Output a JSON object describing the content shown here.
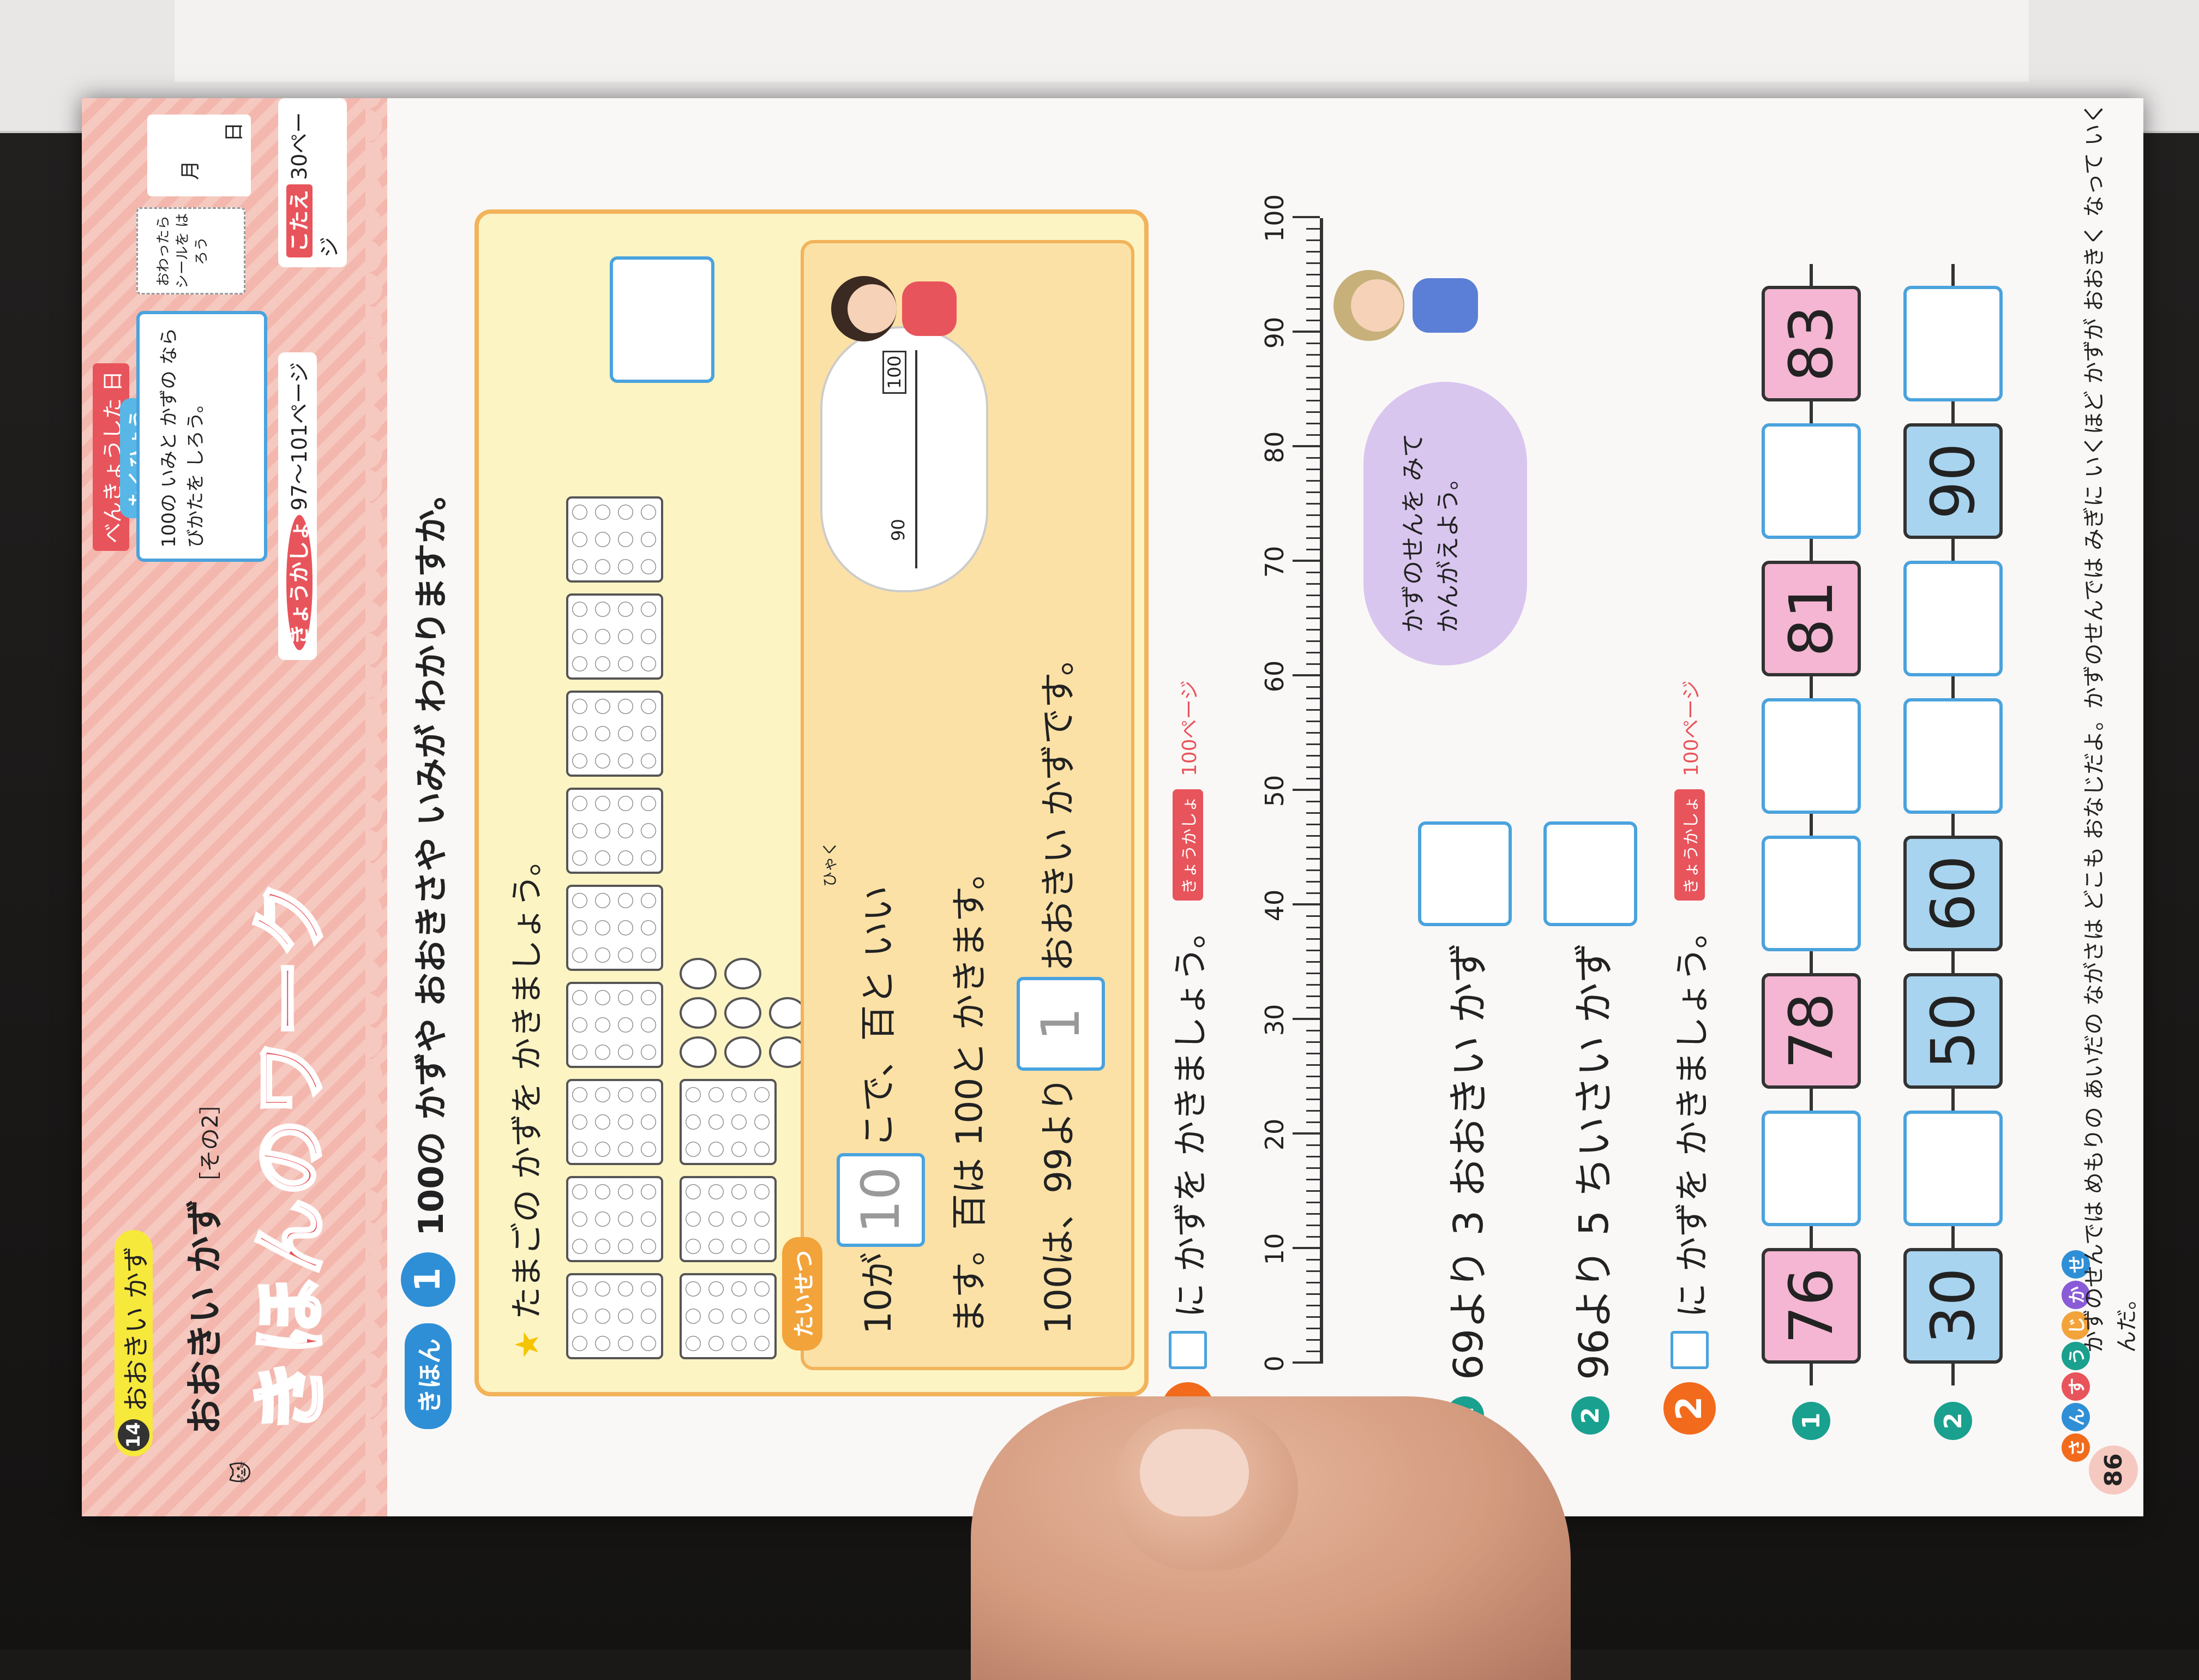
{
  "page": {
    "lesson_number": "14",
    "lesson_tag": "おおきい かず",
    "lesson_title": "おおきい かず",
    "lesson_subtitle": "［その2］",
    "work_title": "きほんのワーク",
    "studied_label": "べんきょうした 日",
    "month_label": "月",
    "day_label": "日",
    "goal_label": "もくひょう",
    "goal_text": "100の いみと かずの ならびかたを しろう。",
    "sticker_text": "おわったら シールを はろう",
    "textbook_ref_tag": "きょうかしょ",
    "textbook_ref": "97～101ページ",
    "answer_tag": "こたえ",
    "answer_ref": "30ページ",
    "page_number": "86"
  },
  "kihon1": {
    "badge": "きほん",
    "number": "1",
    "heading": "100の かずや おおきさや いみが わかりますか。",
    "instruction": "たまごの かずを かきましょう。",
    "taisetsu_label": "たいせつ",
    "line1_pre": "10が",
    "line1_box": "10",
    "line1_post": "こで、百と いい",
    "furigana": "ひゃく",
    "line2": "ます。百は 100と かきます。",
    "line3_pre": "100は、99より",
    "line3_box": "1",
    "line3_post": "おおきい かずです。",
    "cloud_label_90": "90",
    "cloud_label_100": "100"
  },
  "q1": {
    "number": "1",
    "instruction": "に かずを かきましょう。",
    "ref_tag": "きょうかしょ",
    "ref": "100ページ",
    "ruler_labels": [
      "0",
      "10",
      "20",
      "30",
      "40",
      "50",
      "60",
      "70",
      "80",
      "90",
      "100"
    ],
    "sub1_num": "1",
    "sub1_text": "69より 3 おおきい かず",
    "sub2_num": "2",
    "sub2_text": "96より 5 ちいさい かず",
    "bubble": "かずのせんを みて かんがえよう。"
  },
  "q2": {
    "number": "2",
    "instruction": "に かずを かきましょう。",
    "ref_tag": "きょうかしょ",
    "ref": "100ページ",
    "row1_num": "1",
    "row1": [
      {
        "v": "76",
        "c": "pink"
      },
      {
        "v": "",
        "c": "empty"
      },
      {
        "v": "78",
        "c": "pink"
      },
      {
        "v": "",
        "c": "empty"
      },
      {
        "v": "",
        "c": "empty"
      },
      {
        "v": "81",
        "c": "pink"
      },
      {
        "v": "",
        "c": "empty"
      },
      {
        "v": "83",
        "c": "pink"
      }
    ],
    "row2_num": "2",
    "row2": [
      {
        "v": "30",
        "c": "blue"
      },
      {
        "v": "",
        "c": "empty"
      },
      {
        "v": "50",
        "c": "blue"
      },
      {
        "v": "60",
        "c": "blue"
      },
      {
        "v": "",
        "c": "empty"
      },
      {
        "v": "",
        "c": "empty"
      },
      {
        "v": "90",
        "c": "blue"
      },
      {
        "v": "",
        "c": "empty"
      }
    ]
  },
  "footer": {
    "sansu_chars": [
      "さ",
      "ん",
      "す",
      "う",
      "じ",
      "か",
      "せ"
    ],
    "sansu_colors": [
      "#f26b1d",
      "#2f8fd6",
      "#e8545b",
      "#1aa08e",
      "#f2a33a",
      "#8a5bd6",
      "#2f8fd6"
    ],
    "note": "かずのせんでは めもりの あいだの ながさは どこも おなじだよ。かずのせんでは みぎに いくほど かずが おおきく なって いくんだ。"
  },
  "colors": {
    "accent": "#e8545b",
    "blue": "#4aa3dd",
    "yellow_box": "#fdf4c4",
    "pink_cell": "#f4b6d2",
    "blue_cell": "#a9d4ef"
  }
}
